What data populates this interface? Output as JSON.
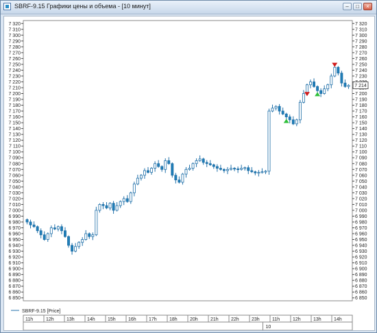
{
  "window": {
    "title": "SBRF-9.15 Графики цены и объема - [10 минут]"
  },
  "colors": {
    "up": "#ffffff",
    "down": "#1f7fb8",
    "outline": "#1f6fa8",
    "sell_marker": "#d11a1a",
    "buy_marker": "#2fbf3a",
    "grid": "#e6e6e6"
  },
  "chart_data": {
    "type": "candlestick",
    "title": "",
    "ylim": [
      6845,
      7325
    ],
    "y_ticks": [
      "7 320",
      "7 310",
      "7 300",
      "7 290",
      "7 280",
      "7 270",
      "7 260",
      "7 250",
      "7 240",
      "7 230",
      "7 220",
      "7 210",
      "7 200",
      "7 190",
      "7 180",
      "7 170",
      "7 160",
      "7 150",
      "7 140",
      "7 130",
      "7 120",
      "7 110",
      "7 100",
      "7 090",
      "7 080",
      "7 070",
      "7 060",
      "7 050",
      "7 040",
      "7 030",
      "7 020",
      "7 010",
      "7 000",
      "6 990",
      "6 980",
      "6 970",
      "6 960",
      "6 950",
      "6 940",
      "6 930",
      "6 920",
      "6 910",
      "6 900",
      "6 890",
      "6 880",
      "6 870",
      "6 860",
      "6 850"
    ],
    "x_ticks": [
      "11h",
      "12h",
      "13h",
      "14h",
      "15h",
      "16h",
      "17h",
      "18h",
      "20h",
      "21h",
      "22h",
      "23h",
      "11h",
      "12h",
      "13h",
      "14h"
    ],
    "x_day_label": "10",
    "current_price_label": "7 214",
    "legend": {
      "series_name": "SBRF-9.15 [Price]"
    },
    "series": [
      {
        "name": "SBRF-9.15 [Price]",
        "closes": [
          6980,
          6975,
          6972,
          6965,
          6958,
          6950,
          6960,
          6970,
          6968,
          6972,
          6965,
          6955,
          6940,
          6930,
          6938,
          6945,
          6950,
          6960,
          6955,
          6958,
          7000,
          7010,
          7008,
          7004,
          7012,
          7000,
          7008,
          7015,
          7020,
          7015,
          7030,
          7045,
          7055,
          7060,
          7068,
          7065,
          7072,
          7080,
          7075,
          7070,
          7085,
          7080,
          7060,
          7052,
          7048,
          7062,
          7070,
          7072,
          7080,
          7085,
          7088,
          7082,
          7080,
          7078,
          7075,
          7072,
          7070,
          7068,
          7070,
          7072,
          7071,
          7070,
          7072,
          7073,
          7068,
          7066,
          7064,
          7065,
          7066,
          7067,
          7170,
          7175,
          7178,
          7170,
          7165,
          7160,
          7155,
          7148,
          7155,
          7185,
          7200,
          7215,
          7220,
          7212,
          7205,
          7200,
          7208,
          7215,
          7230,
          7245,
          7235,
          7218,
          7212,
          7214
        ]
      }
    ],
    "markers": [
      {
        "type": "sell",
        "bar": 81,
        "price": 7198
      },
      {
        "type": "buy",
        "bar": 75,
        "price": 7153
      },
      {
        "type": "buy",
        "bar": 84,
        "price": 7199
      },
      {
        "type": "sell",
        "bar": 89,
        "price": 7248
      }
    ]
  }
}
